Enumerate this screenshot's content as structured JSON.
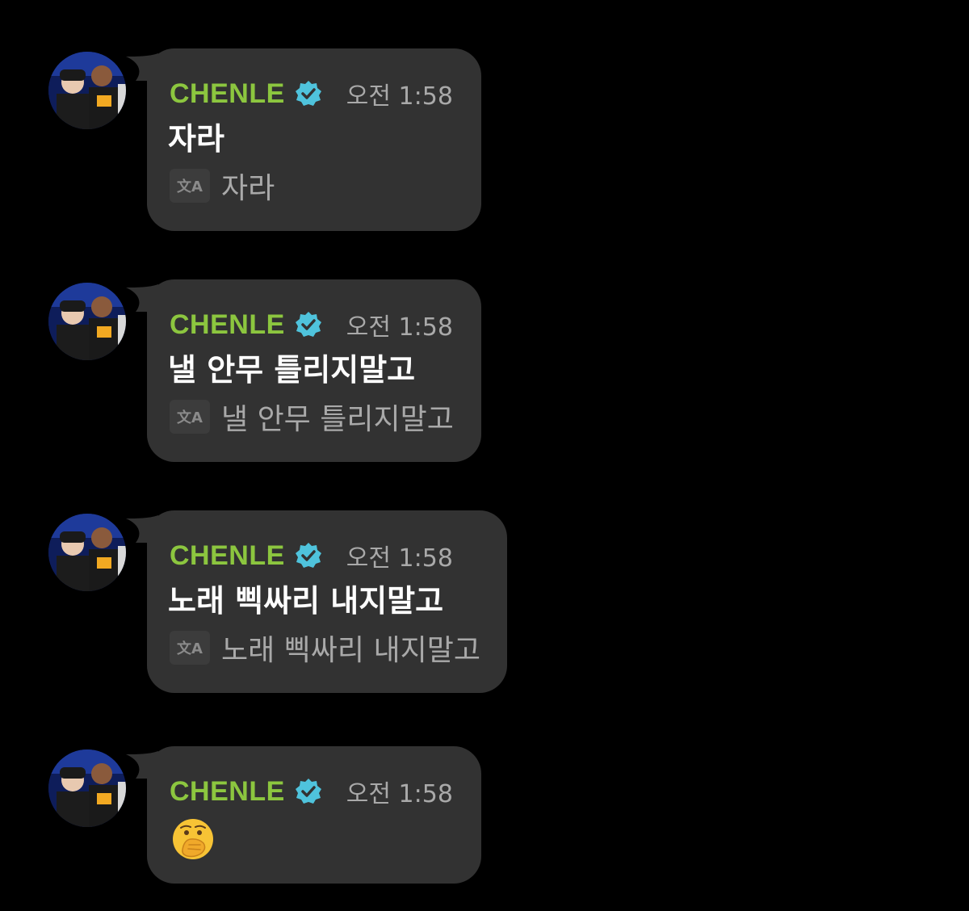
{
  "messages": [
    {
      "sender": "CHENLE",
      "verified_icon": "verified-badge-icon",
      "time": "오전 1:58",
      "text": "자라",
      "translation_icon": "translate-icon",
      "translation_icon_label": "文A",
      "translation": "자라"
    },
    {
      "sender": "CHENLE",
      "verified_icon": "verified-badge-icon",
      "time": "오전 1:58",
      "text": "낼 안무 틀리지말고",
      "translation_icon": "translate-icon",
      "translation_icon_label": "文A",
      "translation": "낼 안무 틀리지말고"
    },
    {
      "sender": "CHENLE",
      "verified_icon": "verified-badge-icon",
      "time": "오전 1:58",
      "text": "노래 삑싸리 내지말고",
      "translation_icon": "translate-icon",
      "translation_icon_label": "文A",
      "translation": "노래 삑싸리 내지말고"
    },
    {
      "sender": "CHENLE",
      "verified_icon": "verified-badge-icon",
      "time": "오전 1:58",
      "emoji": "hand-over-mouth-emoji"
    }
  ],
  "colors": {
    "background": "#000000",
    "bubble": "#323232",
    "sender": "#8cc63f",
    "verified": "#4fc3dc",
    "time": "#a9a9a9",
    "text": "#ffffff",
    "translation": "#a9a9a9"
  }
}
